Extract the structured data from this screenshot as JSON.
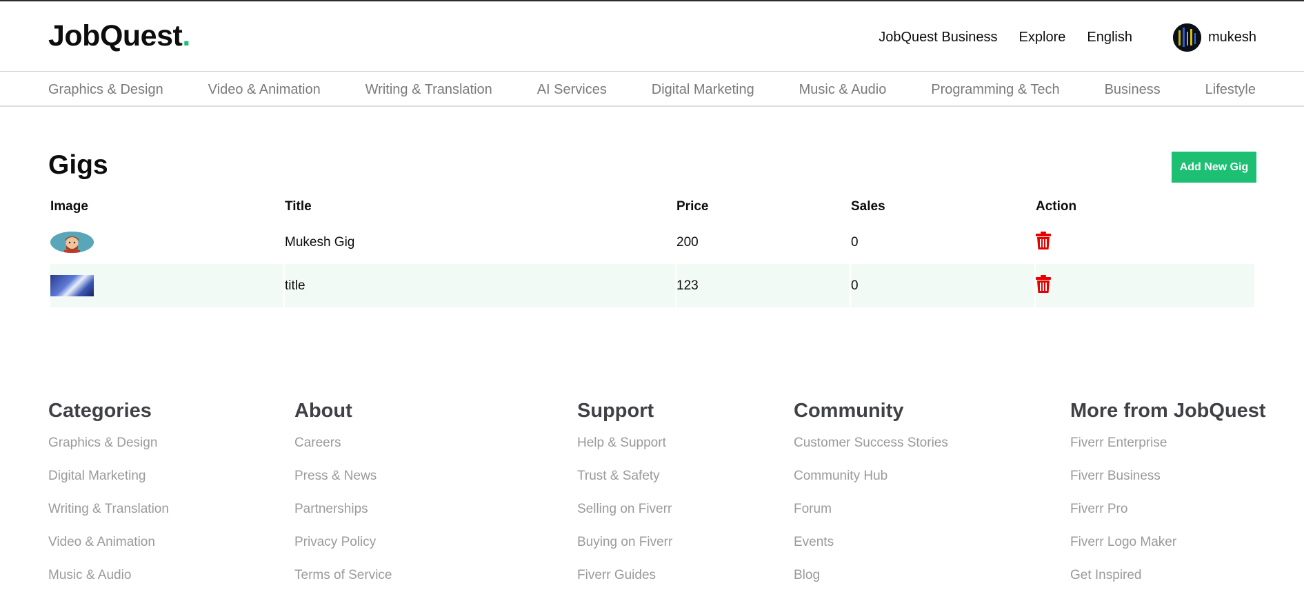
{
  "brand": {
    "name": "JobQuest",
    "dot": ".",
    "accent": "#1dbf73"
  },
  "header": {
    "links": [
      "JobQuest Business",
      "Explore",
      "English"
    ],
    "username": "mukesh"
  },
  "categories_nav": [
    "Graphics & Design",
    "Video & Animation",
    "Writing & Translation",
    "AI Services",
    "Digital Marketing",
    "Music & Audio",
    "Programming & Tech",
    "Business",
    "Lifestyle"
  ],
  "main": {
    "title": "Gigs",
    "add_button": "Add New Gig",
    "columns": [
      "Image",
      "Title",
      "Price",
      "Sales",
      "Action"
    ],
    "rows": [
      {
        "title": "Mukesh Gig",
        "price": "200",
        "sales": "0",
        "action_icon": "trash-icon"
      },
      {
        "title": "title",
        "price": "123",
        "sales": "0",
        "action_icon": "trash-icon"
      }
    ],
    "delete_color": "#e60000"
  },
  "footer": {
    "columns": [
      {
        "heading": "Categories",
        "items": [
          "Graphics & Design",
          "Digital Marketing",
          "Writing & Translation",
          "Video & Animation",
          "Music & Audio"
        ]
      },
      {
        "heading": "About",
        "items": [
          "Careers",
          "Press & News",
          "Partnerships",
          "Privacy Policy",
          "Terms of Service"
        ]
      },
      {
        "heading": "Support",
        "items": [
          "Help & Support",
          "Trust & Safety",
          "Selling on Fiverr",
          "Buying on Fiverr",
          "Fiverr Guides"
        ]
      },
      {
        "heading": "Community",
        "items": [
          "Customer Success Stories",
          "Community Hub",
          "Forum",
          "Events",
          "Blog"
        ]
      },
      {
        "heading": "More from JobQuest",
        "items": [
          "Fiverr Enterprise",
          "Fiverr Business",
          "Fiverr Pro",
          "Fiverr Logo Maker",
          "Get Inspired"
        ]
      }
    ]
  }
}
